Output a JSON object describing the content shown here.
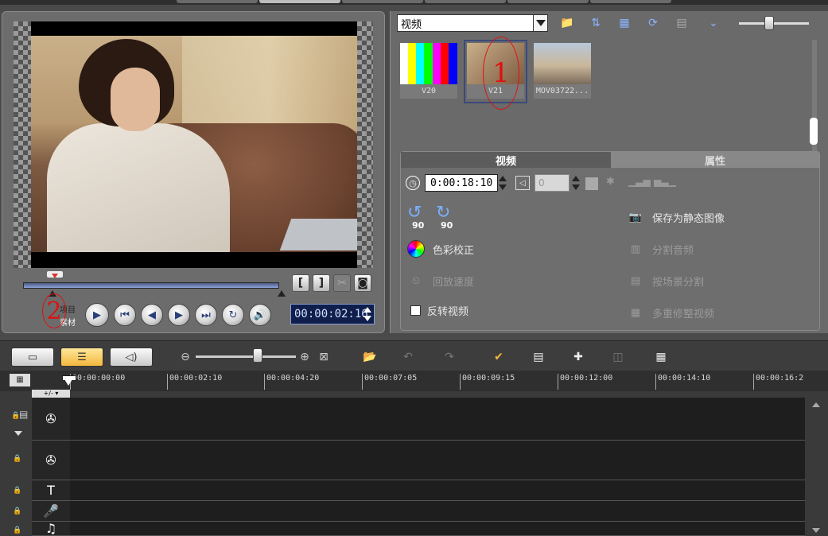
{
  "library": {
    "category": "视频",
    "thumbnails": [
      {
        "caption": "V20"
      },
      {
        "caption": "V21"
      },
      {
        "caption": "MOV03722..."
      }
    ]
  },
  "options": {
    "tabs": [
      "视频",
      "属性"
    ],
    "duration": "0:00:18:10",
    "volume": "0",
    "save_still": "保存为静态图像",
    "color_correction": "色彩校正",
    "split_audio": "分割音频",
    "playback_speed": "回放速度",
    "split_by_scene": "按场景分割",
    "reverse_video": "反转视频",
    "multi_trim": "多重修整视频",
    "rotate_labels": [
      "90",
      "90"
    ]
  },
  "preview": {
    "mode_project": "项目",
    "mode_clip": "素材",
    "timecode": "00:00:02:16",
    "mark_in": "[",
    "mark_out": "]"
  },
  "annotations": [
    "1",
    "2"
  ],
  "timeline": {
    "ruler": [
      "00:00:00:00",
      "00:00:02:10",
      "00:00:04:20",
      "00:00:07:05",
      "00:00:09:15",
      "00:00:12:00",
      "00:00:14:10",
      "00:00:16:2"
    ],
    "title_track": "T"
  },
  "colors": {
    "accent_orange": "#f3b73d",
    "timecode_bg": "#0f1e4a",
    "annotation_red": "#e01010"
  }
}
